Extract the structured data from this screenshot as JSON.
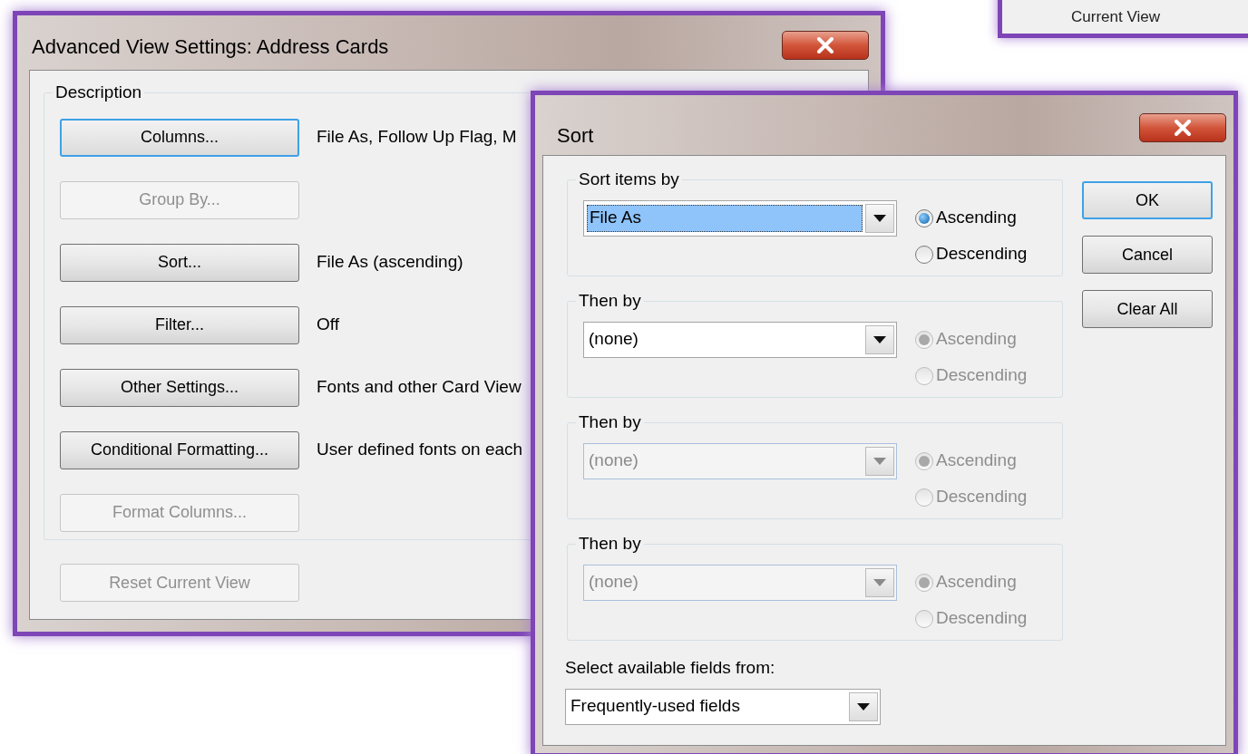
{
  "background_window": {
    "label": "Current View"
  },
  "advanced_view_settings": {
    "title": "Advanced View Settings: Address Cards",
    "group_label": "Description",
    "rows": [
      {
        "button": "Columns...",
        "disabled": false,
        "focused": true,
        "summary": "File As, Follow Up Flag, M"
      },
      {
        "button": "Group By...",
        "disabled": true,
        "focused": false
      },
      {
        "button": "Sort...",
        "disabled": false,
        "focused": false,
        "summary": "File As (ascending)"
      },
      {
        "button": "Filter...",
        "disabled": false,
        "focused": false,
        "summary": "Off"
      },
      {
        "button": "Other Settings...",
        "disabled": false,
        "focused": false,
        "summary": "Fonts and other Card View"
      },
      {
        "button": "Conditional Formatting...",
        "disabled": false,
        "focused": false,
        "summary": "User defined fonts on each"
      },
      {
        "button": "Format Columns...",
        "disabled": true,
        "focused": false
      }
    ],
    "reset_button": {
      "label": "Reset Current View",
      "disabled": true
    }
  },
  "sort_dialog": {
    "title": "Sort",
    "groups": [
      {
        "label": "Sort items by",
        "field": {
          "value": "File As",
          "disabled": false,
          "highlighted": true
        },
        "options": [
          {
            "label": "Ascending",
            "selected": true,
            "disabled": false
          },
          {
            "label": "Descending",
            "selected": false,
            "disabled": false
          }
        ]
      },
      {
        "label": "Then by",
        "field": {
          "value": "(none)",
          "disabled": false,
          "highlighted": false
        },
        "options": [
          {
            "label": "Ascending",
            "selected": true,
            "disabled": true
          },
          {
            "label": "Descending",
            "selected": false,
            "disabled": true
          }
        ]
      },
      {
        "label": "Then by",
        "field": {
          "value": "(none)",
          "disabled": true,
          "highlighted": false
        },
        "options": [
          {
            "label": "Ascending",
            "selected": true,
            "disabled": true
          },
          {
            "label": "Descending",
            "selected": false,
            "disabled": true
          }
        ]
      },
      {
        "label": "Then by",
        "field": {
          "value": "(none)",
          "disabled": true,
          "highlighted": false
        },
        "options": [
          {
            "label": "Ascending",
            "selected": true,
            "disabled": true
          },
          {
            "label": "Descending",
            "selected": false,
            "disabled": true
          }
        ]
      }
    ],
    "buttons": [
      {
        "label": "OK",
        "default": true
      },
      {
        "label": "Cancel",
        "default": false
      },
      {
        "label": "Clear All",
        "default": false
      }
    ],
    "fields_from": {
      "label": "Select available fields from:",
      "value": "Frequently-used fields"
    }
  }
}
